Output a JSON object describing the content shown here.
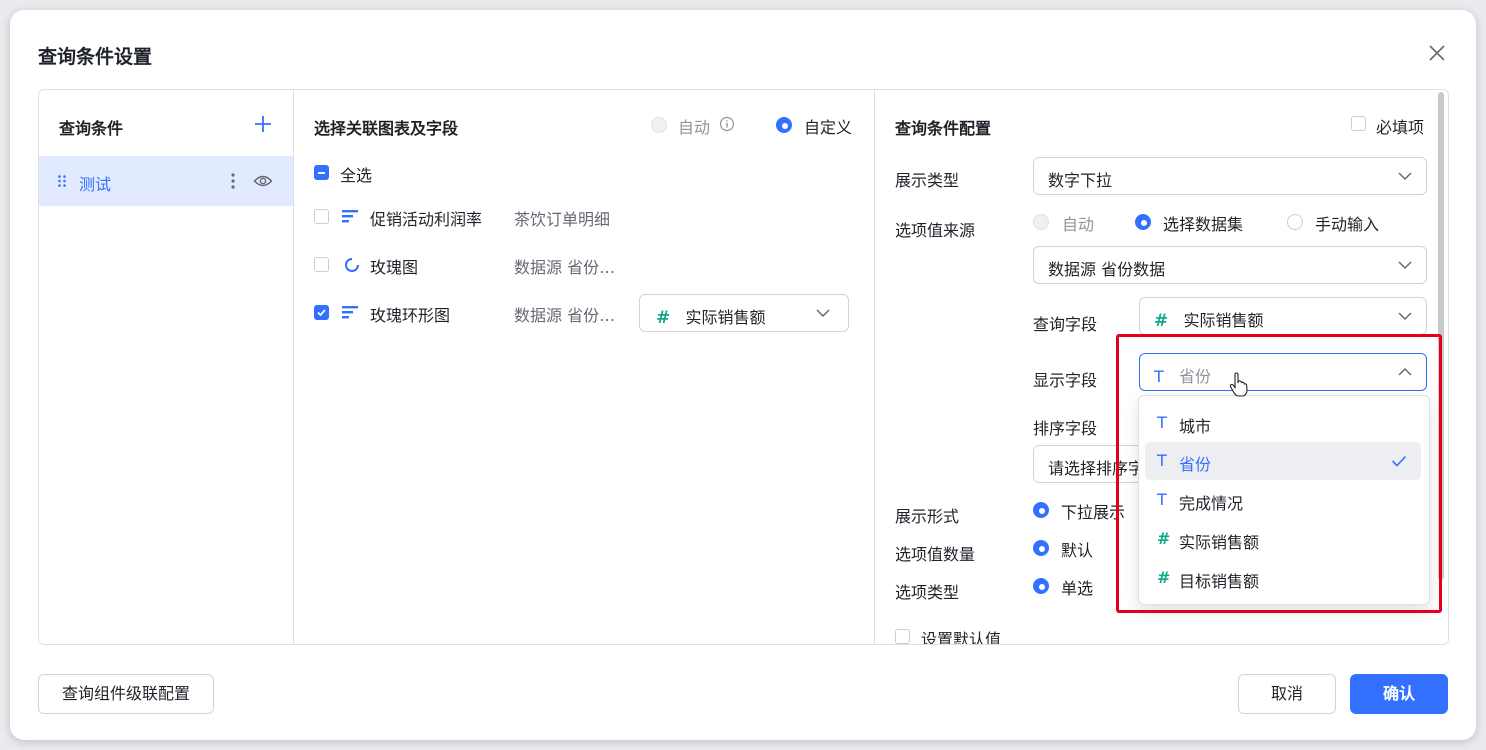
{
  "dialog": {
    "title": "查询条件设置"
  },
  "conditions_panel": {
    "header": "查询条件",
    "items": [
      {
        "label": "测试"
      }
    ]
  },
  "link_panel": {
    "header": "选择关联图表及字段",
    "mode_auto": "自动",
    "mode_custom": "自定义",
    "select_all": "全选",
    "rows": [
      {
        "chart": "促销活动利润率",
        "source": "茶饮订单明细",
        "checked": false
      },
      {
        "chart": "玫瑰图",
        "source": "数据源 省份…",
        "checked": false
      },
      {
        "chart": "玫瑰环形图",
        "source": "数据源 省份…",
        "checked": true,
        "field": "实际销售额"
      }
    ]
  },
  "config_panel": {
    "header": "查询条件配置",
    "required_label": "必填项",
    "display_type_label": "展示类型",
    "display_type_value": "数字下拉",
    "option_source_label": "选项值来源",
    "source_auto": "自动",
    "source_dataset": "选择数据集",
    "source_manual": "手动输入",
    "dataset_value": "数据源 省份数据",
    "query_field_label": "查询字段",
    "query_field_value": "实际销售额",
    "display_field_label": "显示字段",
    "display_field_value": "省份",
    "sort_field_label": "排序字段",
    "sort_field_placeholder": "请选择排序字",
    "display_form_label": "展示形式",
    "display_form_value": "下拉展示",
    "option_count_label": "选项值数量",
    "option_count_value": "默认",
    "option_type_label": "选项类型",
    "option_type_value": "单选",
    "default_value_label": "设置默认值"
  },
  "dropdown": {
    "options": [
      {
        "label": "城市",
        "type": "T",
        "selected": false
      },
      {
        "label": "省份",
        "type": "T",
        "selected": true
      },
      {
        "label": "完成情况",
        "type": "T",
        "selected": false
      },
      {
        "label": "实际销售额",
        "type": "#",
        "selected": false
      },
      {
        "label": "目标销售额",
        "type": "#",
        "selected": false
      }
    ]
  },
  "footer": {
    "cascade_button": "查询组件级联配置",
    "cancel_button": "取消",
    "confirm_button": "确认"
  },
  "icons": {
    "close": "close-icon",
    "add": "plus-icon",
    "drag": "drag-handle-icon",
    "more": "more-vertical-icon",
    "eye": "eye-icon",
    "info": "info-icon",
    "bar_chart": "bar-chart-icon",
    "rose_chart": "ring-chart-icon",
    "text_field": "text-field-icon",
    "number_field": "number-field-icon",
    "chevron": "chevron-down-icon",
    "check": "check-icon",
    "cursor": "hand-cursor-icon"
  },
  "colors": {
    "accent": "#3370ff",
    "number_type": "#14a98b",
    "highlight_box": "#e3001b",
    "selected_row_bg": "#e1eaff"
  }
}
